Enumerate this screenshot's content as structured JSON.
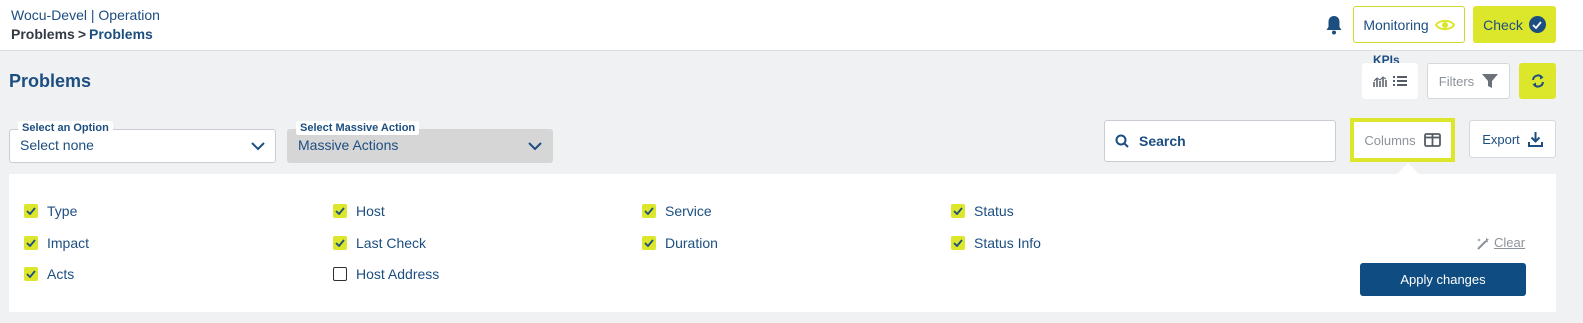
{
  "header": {
    "app_title": "Wocu-Devel | Operation",
    "breadcrumb": {
      "root": "Problems",
      "separator": ">",
      "current": "Problems"
    },
    "monitoring_label": "Monitoring",
    "check_label": "Check"
  },
  "page": {
    "title": "Problems",
    "kpis_label": "KPIs",
    "filters_label": "Filters"
  },
  "toolbar": {
    "select_option": {
      "label": "Select an Option",
      "value": "Select none"
    },
    "massive_action": {
      "label": "Select Massive Action",
      "value": "Massive Actions"
    },
    "search_placeholder": "Search",
    "columns_label": "Columns",
    "export_label": "Export"
  },
  "columns_panel": {
    "items": [
      {
        "label": "Type",
        "checked": true
      },
      {
        "label": "Host",
        "checked": true
      },
      {
        "label": "Service",
        "checked": true
      },
      {
        "label": "Status",
        "checked": true
      },
      {
        "label": "Impact",
        "checked": true
      },
      {
        "label": "Last Check",
        "checked": true
      },
      {
        "label": "Duration",
        "checked": true
      },
      {
        "label": "Status Info",
        "checked": true
      },
      {
        "label": "Acts",
        "checked": true
      },
      {
        "label": "Host Address",
        "checked": false
      }
    ],
    "clear_label": "Clear",
    "apply_label": "Apply changes"
  },
  "colors": {
    "accent": "#dce62a",
    "primary": "#1c4e80",
    "apply": "#0f4c81"
  },
  "icons": [
    "bell-icon",
    "eye-icon",
    "check-circle-icon",
    "chart-icon",
    "list-icon",
    "filter-icon",
    "refresh-icon",
    "chevron-down-icon",
    "search-icon",
    "columns-icon",
    "download-icon",
    "magic-wand-icon"
  ]
}
